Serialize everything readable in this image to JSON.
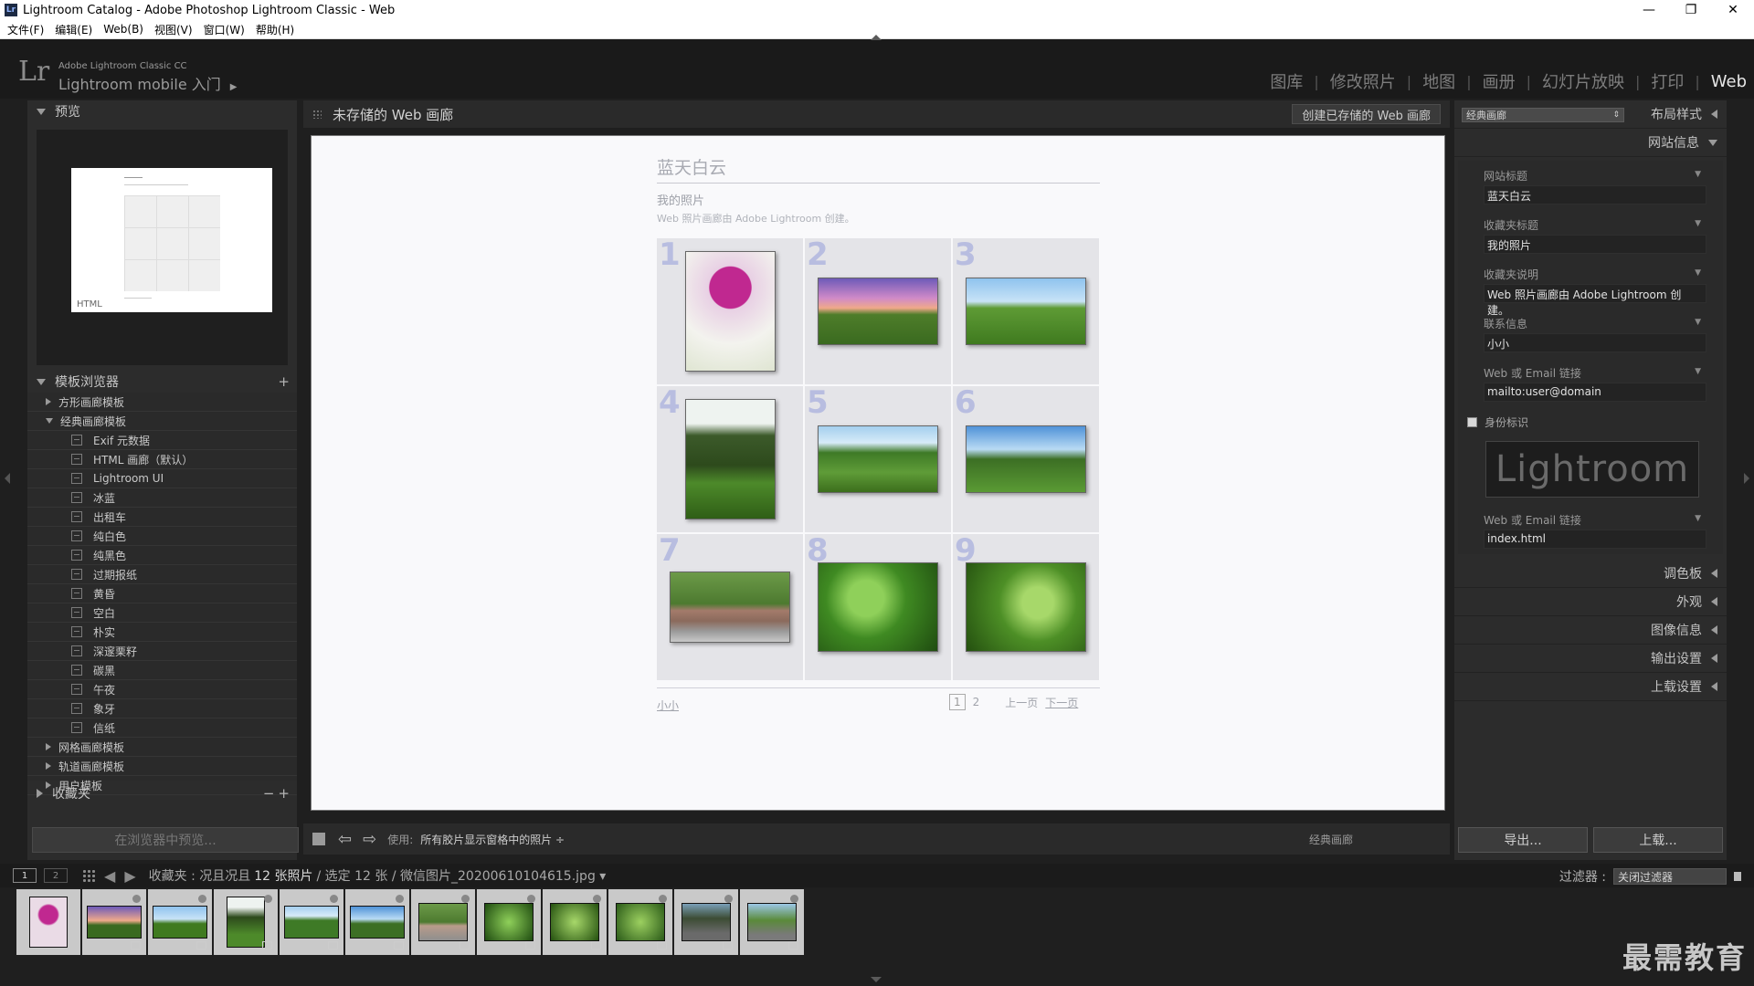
{
  "window": {
    "title": "Lightroom Catalog - Adobe Photoshop Lightroom Classic - Web",
    "app_badge": "Lr"
  },
  "menu": [
    "文件(F)",
    "编辑(E)",
    "Web(B)",
    "视图(V)",
    "窗口(W)",
    "帮助(H)"
  ],
  "identity": {
    "logo": "Lr",
    "small": "Adobe Lightroom Classic CC",
    "big": "Lightroom mobile 入门"
  },
  "modules": [
    "图库",
    "修改照片",
    "地图",
    "画册",
    "幻灯片放映",
    "打印",
    "Web"
  ],
  "modules_active": "Web",
  "left": {
    "preview_header": "预览",
    "preview_html_label": "HTML",
    "template_header": "模板浏览器",
    "folders": [
      {
        "label": "方形画廊模板",
        "open": false
      },
      {
        "label": "经典画廊模板",
        "open": true,
        "items": [
          "Exif 元数据",
          "HTML 画廊（默认）",
          "Lightroom UI",
          "冰蓝",
          "出租车",
          "纯白色",
          "纯黑色",
          "过期报纸",
          "黄昏",
          "空白",
          "朴实",
          "深邃栗籽",
          "碳黑",
          "午夜",
          "象牙",
          "信纸"
        ]
      },
      {
        "label": "网格画廊模板",
        "open": false
      },
      {
        "label": "轨道画廊模板",
        "open": false
      },
      {
        "label": "用户模板",
        "open": false
      }
    ],
    "collections_header": "收藏夹",
    "preview_in_browser": "在浏览器中预览..."
  },
  "center": {
    "header_title": "未存储的 Web 画廊",
    "create_button": "创建已存储的 Web 画廊",
    "gallery": {
      "site_title": "蓝天白云",
      "collection_title": "我的照片",
      "description": "Web 照片画廊由 Adobe Lightroom 创建。",
      "cells": [
        "1",
        "2",
        "3",
        "4",
        "5",
        "6",
        "7",
        "8",
        "9"
      ],
      "contact": "小小",
      "page_current": "1",
      "page_other": "2",
      "prev": "上一页",
      "next": "下一页"
    },
    "toolbar": {
      "use_label": "使用:",
      "use_value": "所有胶片显示窗格中的照片 ÷",
      "template_name": "经典画廊"
    }
  },
  "right": {
    "layout_style_select": "经典画廊",
    "layout_style_label": "布局样式",
    "site_info_label": "网站信息",
    "fields": [
      {
        "label": "网站标题",
        "value": "蓝天白云"
      },
      {
        "label": "收藏夹标题",
        "value": "我的照片"
      },
      {
        "label": "收藏夹说明",
        "value": "Web 照片画廊由 Adobe Lightroom 创建。"
      },
      {
        "label": "联系信息",
        "value": "小小"
      },
      {
        "label": "Web 或 Email 链接",
        "value": "mailto:user@domain"
      }
    ],
    "identity_plate_label": "身份标识",
    "identity_plate_text": "Lightroom",
    "plate_link": {
      "label": "Web 或 Email 链接",
      "value": "index.html"
    },
    "sections": [
      "调色板",
      "外观",
      "图像信息",
      "输出设置",
      "上载设置"
    ],
    "export_button": "导出...",
    "upload_button": "上载..."
  },
  "filmstrip": {
    "screen1": "1",
    "screen2": "2",
    "source_prefix": "收藏夹 : 况且况且",
    "count": "12 张照片",
    "source_suffix": "/ 选定 12 张 / 微信图片_20200610104615.jpg ▾",
    "filter_label": "过滤器 :",
    "filter_value": "关闭过滤器"
  },
  "watermark": "最需教育"
}
